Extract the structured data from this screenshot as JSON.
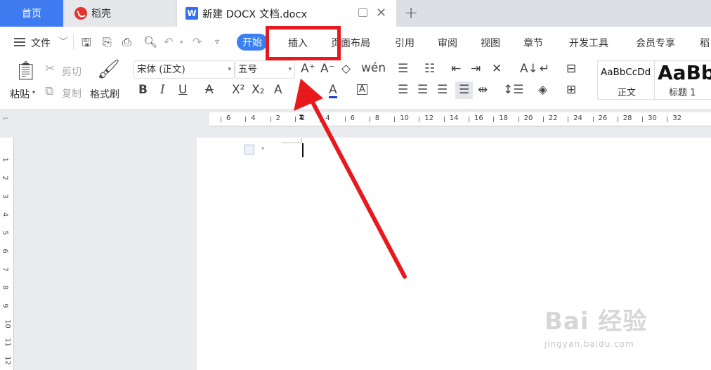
{
  "tabs": {
    "home": "首页",
    "daoke": "稻壳",
    "document": "新建 DOCX 文档.docx"
  },
  "menu": {
    "file": "文件",
    "start": "开始",
    "insert": "插入",
    "page_layout": "页面布局",
    "references": "引用",
    "review": "审阅",
    "view": "视图",
    "chapter": "章节",
    "developer": "开发工具",
    "member": "会员专享",
    "more": "稻"
  },
  "ribbon": {
    "paste": "粘贴",
    "cut": "剪切",
    "copy": "复制",
    "format_painter": "格式刷",
    "font_name": "宋体 (正文)",
    "font_size": "五号",
    "styles": [
      {
        "preview": "AaBbCcDd",
        "label": "正文"
      },
      {
        "preview": "AaBb",
        "label": "标题 1"
      }
    ]
  },
  "ruler": {
    "horizontal": [
      "6",
      "4",
      "2",
      "2",
      "4",
      "6",
      "8",
      "10",
      "12",
      "14",
      "16",
      "18",
      "20",
      "22",
      "24",
      "26",
      "28",
      "30",
      "32"
    ],
    "vertical": [
      "1",
      "2",
      "3",
      "4",
      "5",
      "6",
      "7",
      "8",
      "9",
      "10",
      "11",
      "12"
    ]
  },
  "watermark": {
    "brand": "Bai 经验",
    "url": "jingyan.baidu.com"
  },
  "colors": {
    "accent_blue": "#3a80f0",
    "home_tab": "#3f7bf0",
    "annotation_red": "#e8191c"
  }
}
